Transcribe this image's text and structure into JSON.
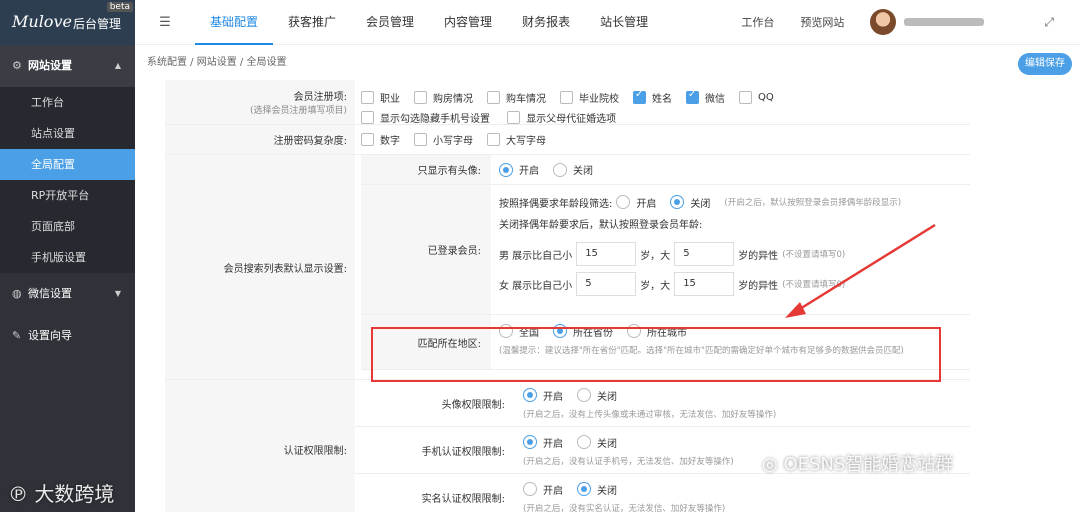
{
  "logo": {
    "script": "Mulove",
    "name": "后台管理",
    "beta": "beta"
  },
  "sidebar": {
    "groups": [
      {
        "label": "网站设置",
        "items": [
          "工作台",
          "站点设置",
          "全局配置",
          "RP开放平台",
          "页面底部",
          "手机版设置"
        ]
      },
      {
        "label": "微信设置"
      },
      {
        "label": "设置向导"
      }
    ]
  },
  "nav": [
    "基础配置",
    "获客推广",
    "会员管理",
    "内容管理",
    "财务报表",
    "站长管理"
  ],
  "top": {
    "workbench": "工作台",
    "preview": "预览网站"
  },
  "breadcrumb": "系统配置 / 网站设置 / 全局设置",
  "save": "编辑保存",
  "reg": {
    "label": "会员注册项:",
    "sub": "(选择会员注册填写项目)",
    "opts": [
      {
        "t": "职业",
        "on": false
      },
      {
        "t": "购房情况",
        "on": false
      },
      {
        "t": "购车情况",
        "on": false
      },
      {
        "t": "毕业院校",
        "on": false
      },
      {
        "t": "姓名",
        "on": true
      },
      {
        "t": "微信",
        "on": true
      },
      {
        "t": "QQ",
        "on": false
      }
    ],
    "opts2": [
      "显示勾选隐藏手机号设置",
      "显示父母代征婚选项"
    ]
  },
  "pwd": {
    "label": "注册密码复杂度:",
    "opts": [
      "数字",
      "小写字母",
      "大写字母"
    ]
  },
  "search": {
    "label": "会员搜索列表默认显示设置:",
    "avatar": {
      "label": "只显示有头像:",
      "on": "开启",
      "off": "关闭"
    },
    "logged": {
      "label": "已登录会员:",
      "filter": "按照择偶要求年龄段筛选:",
      "on": "开启",
      "off": "关闭",
      "filter_hint": "(开启之后，默认按照登录会员择偶年龄段显示)",
      "note": "关闭择偶年龄要求后，默认按照登录会员年龄:",
      "male": {
        "pre": "男 展示比自己小",
        "v1": "15",
        "mid": "岁，大",
        "v2": "5",
        "post": "岁的异性",
        "hint": "(不设置请填写0)"
      },
      "female": {
        "pre": "女 展示比自己小",
        "v1": "5",
        "mid": "岁，大",
        "v2": "15",
        "post": "岁的异性",
        "hint": "(不设置请填写0)"
      }
    },
    "region": {
      "label": "匹配所在地区:",
      "opts": [
        "全国",
        "所在省份",
        "所在城市"
      ],
      "hint": "(温馨提示：建议选择\"所在省份\"匹配。选择\"所在城市\"匹配的需确定好单个城市有足够多的数据供会员匹配)"
    }
  },
  "auth": {
    "label": "认证权限限制:",
    "rows": [
      {
        "label": "头像权限限制:",
        "on": "开启",
        "off": "关闭",
        "hint": "(开启之后，没有上传头像或未通过审核，无法发信、加好友等操作)"
      },
      {
        "label": "手机认证权限限制:",
        "on": "开启",
        "off": "关闭",
        "hint": "(开启之后，没有认证手机号，无法发信、加好友等操作)"
      },
      {
        "label": "实名认证权限限制:",
        "on": "开启",
        "off": "关闭",
        "hint": "(开启之后，没有实名认证，无法发信、加好友等操作)"
      }
    ]
  },
  "watermarks": {
    "left": "大数跨境",
    "right": "OESNS智能婚恋站群"
  }
}
